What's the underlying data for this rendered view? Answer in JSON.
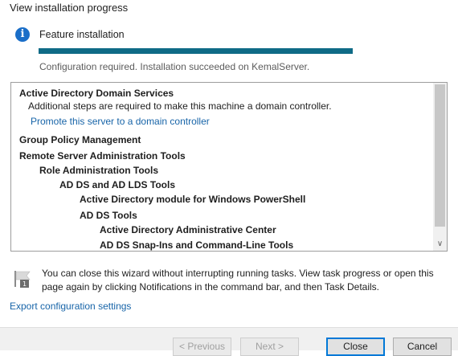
{
  "page": {
    "heading": "View installation progress"
  },
  "progress": {
    "icon": "info-icon",
    "label": "Feature installation",
    "percent": 100,
    "fill_color": "#0f6b86",
    "status": "Configuration required. Installation succeeded on KemalServer."
  },
  "results": {
    "items": [
      {
        "text": "Active Directory Domain Services",
        "bold": true,
        "link": false
      },
      {
        "text": "Additional steps are required to make this machine a domain controller.",
        "bold": false,
        "link": false
      },
      {
        "text": "Promote this server to a domain controller",
        "bold": false,
        "link": true
      },
      {
        "text": "Group Policy Management",
        "bold": true,
        "link": false
      },
      {
        "text": "Remote Server Administration Tools",
        "bold": true,
        "link": false
      },
      {
        "text": "Role Administration Tools",
        "bold": true,
        "link": false
      },
      {
        "text": "AD DS and AD LDS Tools",
        "bold": true,
        "link": false
      },
      {
        "text": "Active Directory module for Windows PowerShell",
        "bold": true,
        "link": false
      },
      {
        "text": "AD DS Tools",
        "bold": true,
        "link": false
      },
      {
        "text": "Active Directory Administrative Center",
        "bold": true,
        "link": false
      },
      {
        "text": "AD DS Snap-Ins and Command-Line Tools",
        "bold": true,
        "link": false
      }
    ]
  },
  "notice": {
    "icon": "flag-icon",
    "text": "You can close this wizard without interrupting running tasks. View task progress or open this page again by clicking Notifications in the command bar, and then Task Details."
  },
  "export": {
    "label": "Export configuration settings"
  },
  "buttons": {
    "previous": "< Previous",
    "next": "Next >",
    "close": "Close",
    "cancel": "Cancel"
  }
}
